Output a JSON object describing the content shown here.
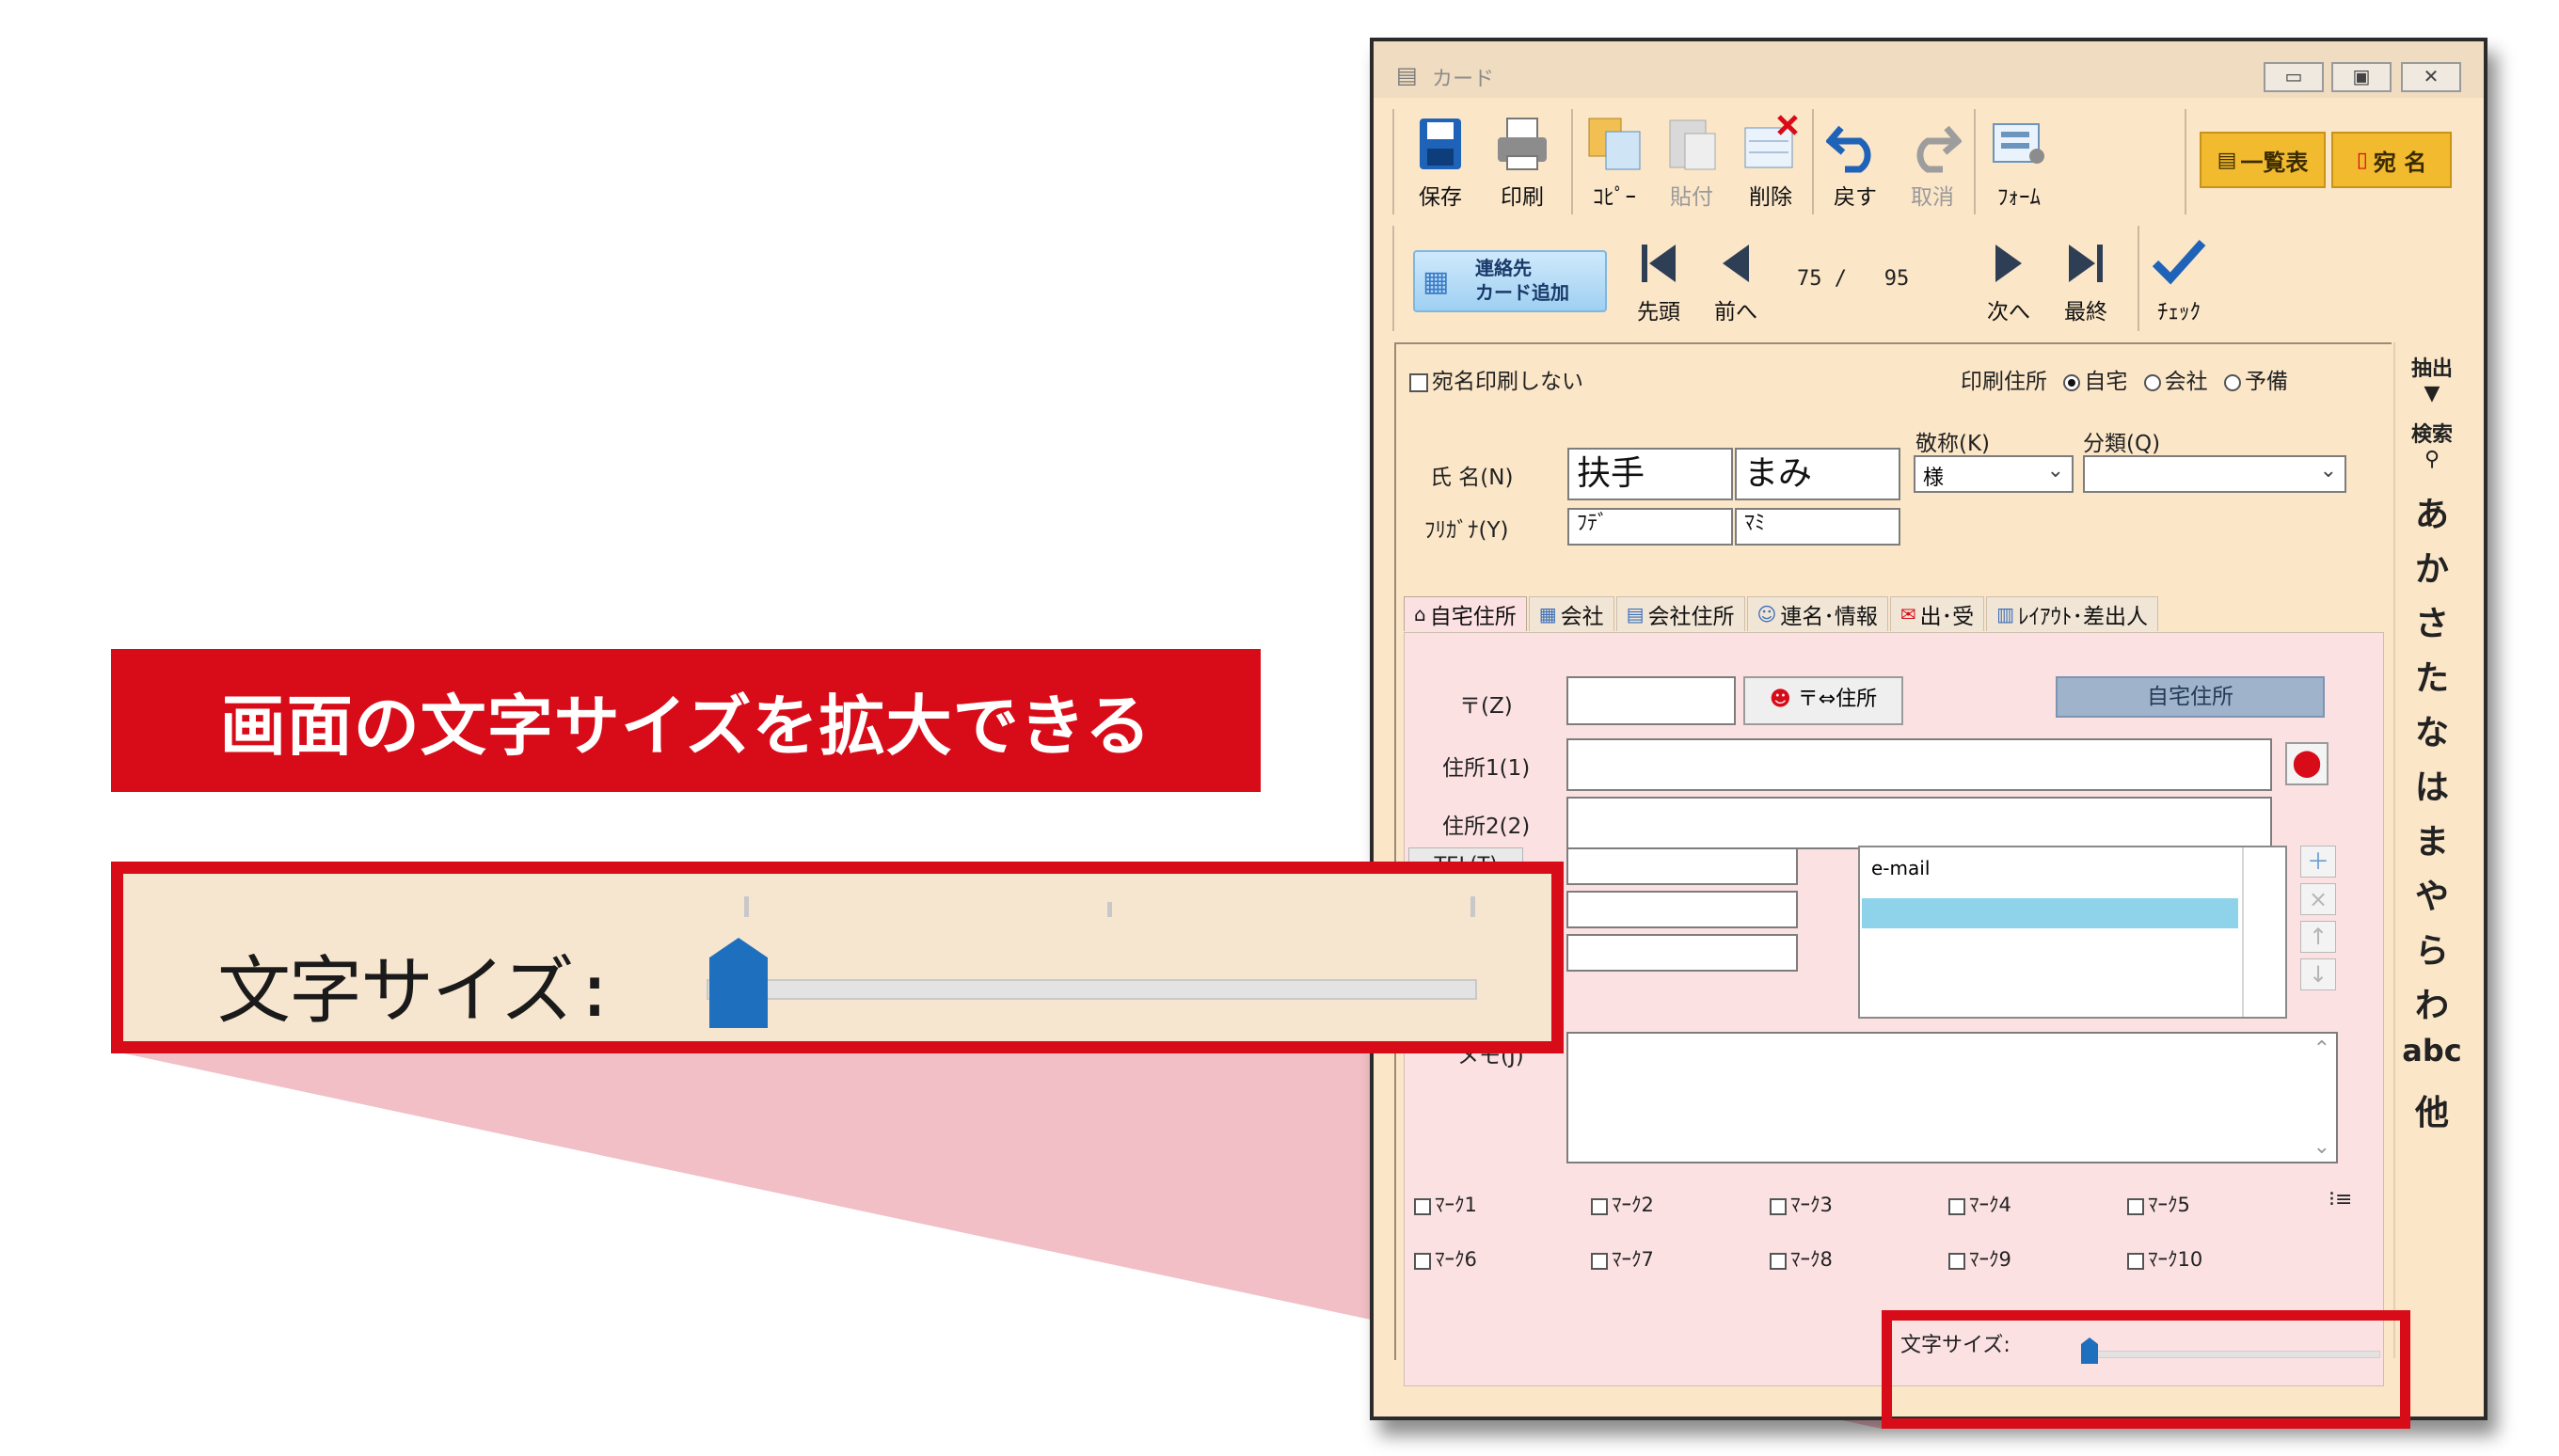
{
  "callout": {
    "banner_text": "画面の文字サイズを拡大できる",
    "zoom_label": "文字サイズ:"
  },
  "window": {
    "title": "カード",
    "controls": [
      "minimize",
      "maximize",
      "close"
    ]
  },
  "toolbar": {
    "save": "保存",
    "print": "印刷",
    "copy": "ｺﾋﾟｰ",
    "paste": "貼付",
    "delete": "削除",
    "undo": "戻す",
    "redo": "取消",
    "form": "ﾌｫｰﾑ",
    "list": "一覧表",
    "address_label": "宛 名"
  },
  "nav": {
    "add_contact": "連絡先\nカード追加",
    "first": "先頭",
    "prev": "前へ",
    "position": "75 /   95",
    "next": "次へ",
    "last": "最終",
    "check": "ﾁｪｯｸ"
  },
  "form": {
    "no_print_address": "宛名印刷しない",
    "print_address_label": "印刷住所",
    "print_address_options": [
      "自宅",
      "会社",
      "予備"
    ],
    "print_address_selected": "自宅",
    "honorific_label": "敬称(K)",
    "honorific_value": "様",
    "category_label": "分類(Q)",
    "category_value": "",
    "name_label": "氏  名(N)",
    "last_name": "扶手",
    "first_name": "まみ",
    "kana_label": "ﾌﾘｶﾞﾅ(Y)",
    "last_kana": "ﾌﾃﾞ",
    "first_kana": "ﾏﾐ"
  },
  "tabs": [
    "自宅住所",
    "会社",
    "会社住所",
    "連名･情報",
    "出･受",
    "ﾚｲｱｳﾄ･差出人"
  ],
  "address": {
    "zip_label": "〒(Z)",
    "zip_value": "",
    "zip_button": "〒⇔住所",
    "home_badge": "自宅住所",
    "addr1_label": "住所1(1)",
    "addr1_value": "",
    "addr2_label": "住所2(2)",
    "addr2_value": "",
    "tel_label": "TEL(T)",
    "email_header": "e-mail",
    "memo_label": "メモ(J)"
  },
  "marks": [
    "ﾏｰｸ1",
    "ﾏｰｸ2",
    "ﾏｰｸ3",
    "ﾏｰｸ4",
    "ﾏｰｸ5",
    "ﾏｰｸ6",
    "ﾏｰｸ7",
    "ﾏｰｸ8",
    "ﾏｰｸ9",
    "ﾏｰｸ10"
  ],
  "index_bar": {
    "extract": "抽出",
    "search": "検索",
    "kana": [
      "あ",
      "か",
      "さ",
      "た",
      "な",
      "は",
      "ま",
      "や",
      "ら",
      "わ",
      "abc",
      "他"
    ]
  },
  "font_size": {
    "label": "文字サイズ:",
    "level": 0
  },
  "colors": {
    "accent_red": "#d80c18",
    "window_bg": "#fbe6c8",
    "tab_body": "#fce1e3",
    "slider_thumb": "#1f6fbf",
    "email_highlight": "#8fd3ea"
  }
}
